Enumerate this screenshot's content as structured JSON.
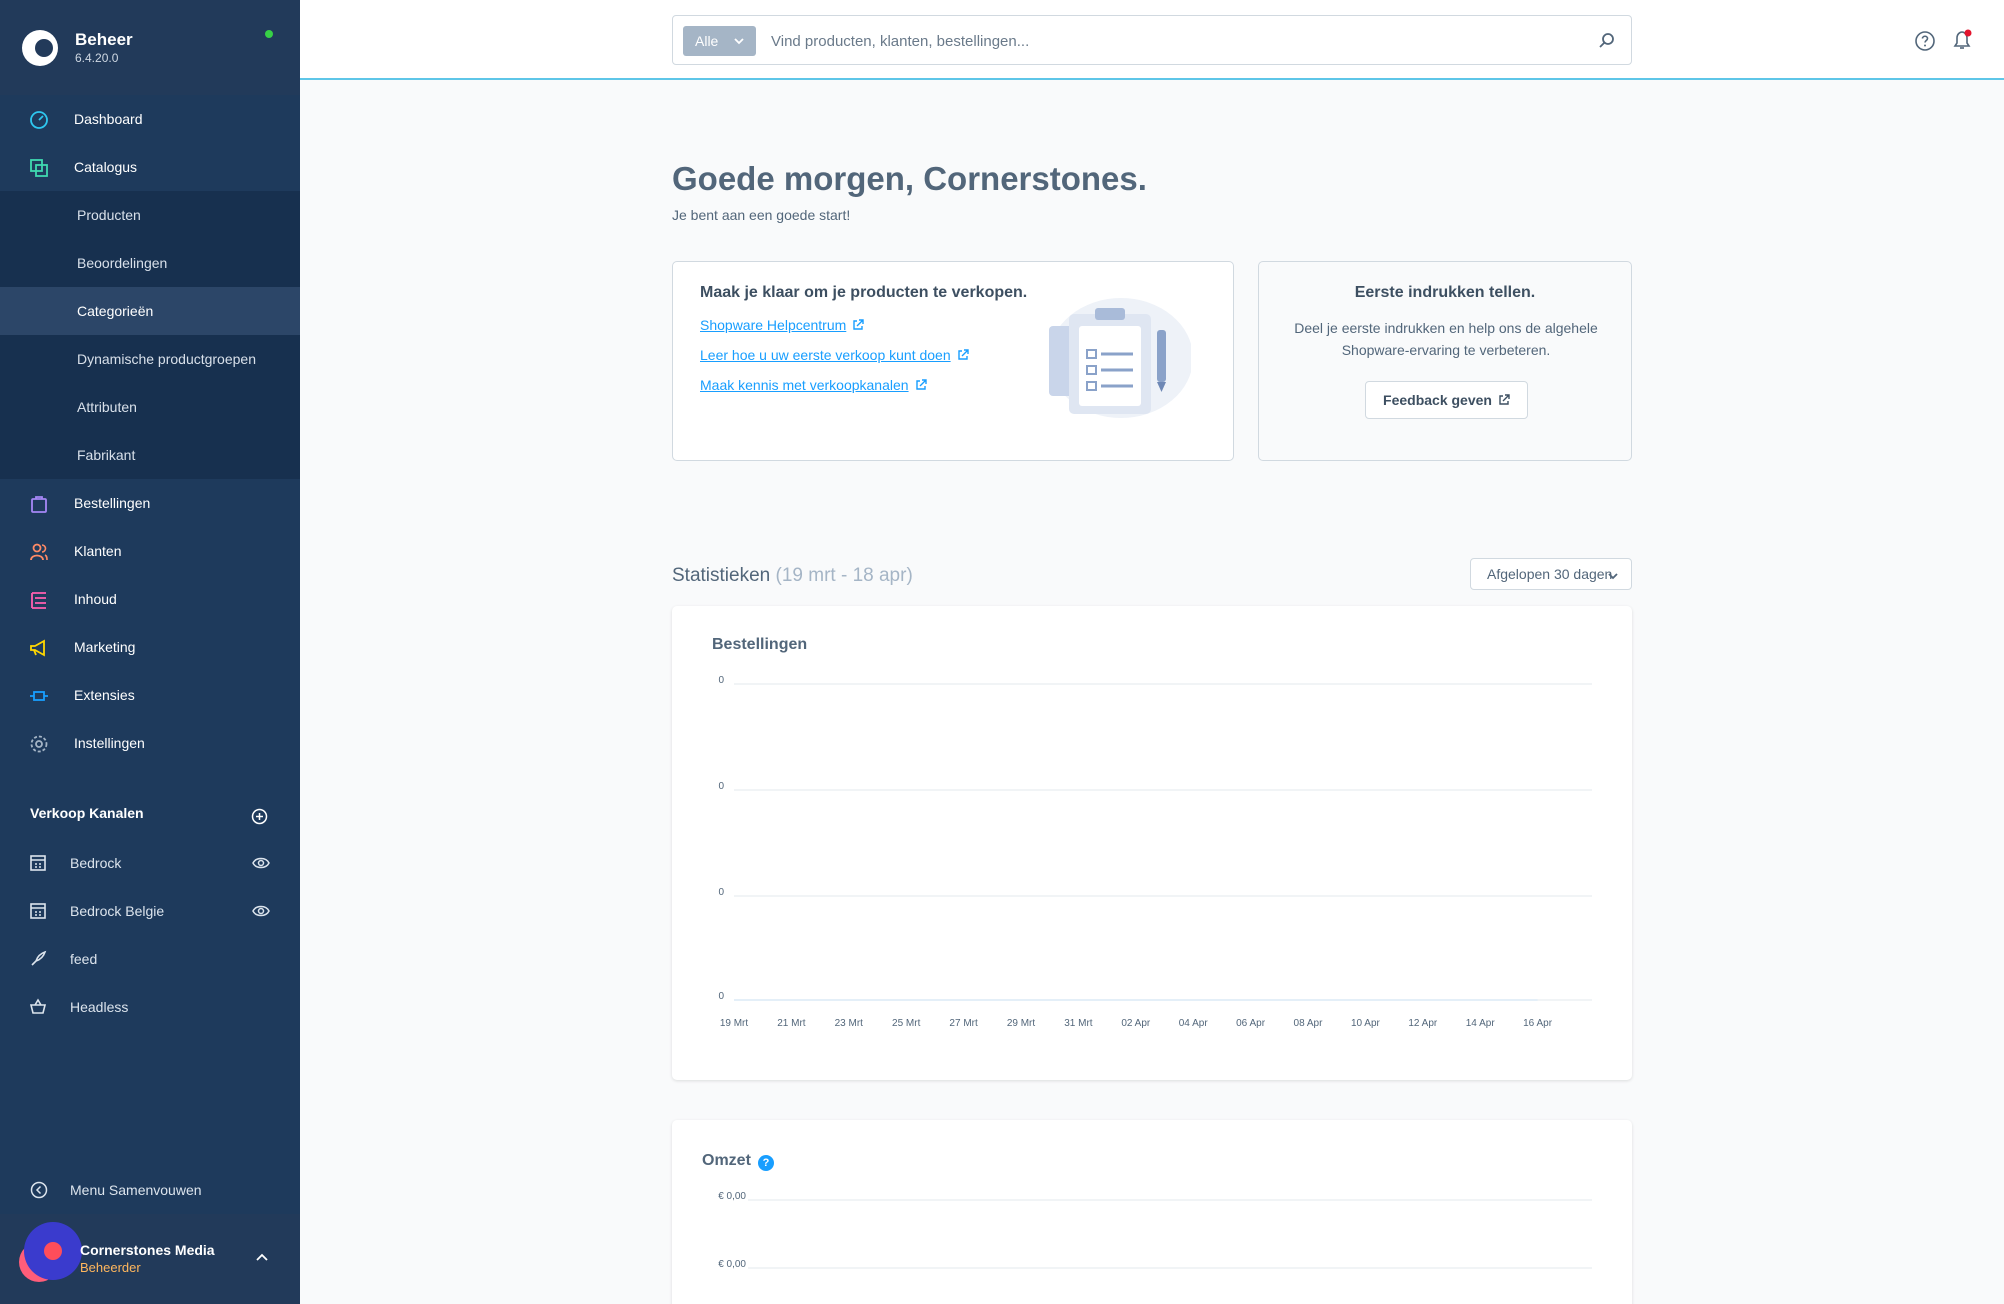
{
  "brand": {
    "name": "Beheer",
    "version": "6.4.20.0"
  },
  "nav": {
    "dashboard": "Dashboard",
    "catalogus": "Catalogus",
    "producten": "Producten",
    "beoordelingen": "Beoordelingen",
    "categorieen": "Categorieën",
    "dynamisch": "Dynamische productgroepen",
    "attributen": "Attributen",
    "fabrikant": "Fabrikant",
    "bestellingen": "Bestellingen",
    "klanten": "Klanten",
    "inhoud": "Inhoud",
    "marketing": "Marketing",
    "extensies": "Extensies",
    "instellingen": "Instellingen"
  },
  "sales_channels": {
    "heading": "Verkoop Kanalen",
    "items": [
      "Bedrock",
      "Bedrock Belgie",
      "feed",
      "Headless"
    ]
  },
  "collapse_label": "Menu Samenvouwen",
  "user": {
    "name": "Cornerstones Media",
    "role": "Beheerder"
  },
  "search": {
    "filter": "Alle",
    "placeholder": "Vind producten, klanten, bestellingen..."
  },
  "greeting": {
    "title": "Goede morgen, Cornerstones.",
    "subtitle": "Je bent aan een goede start!"
  },
  "ready_card": {
    "title": "Maak je klaar om je producten te verkopen.",
    "links": [
      "Shopware Helpcentrum",
      "Leer hoe u uw eerste verkoop kunt doen",
      "Maak kennis met verkoopkanalen"
    ]
  },
  "feedback_card": {
    "title": "Eerste indrukken tellen.",
    "text": "Deel je eerste indrukken en help ons de algehele Shopware-ervaring te verbeteren.",
    "button": "Feedback geven"
  },
  "stats": {
    "title": "Statistieken",
    "range": "(19 mrt - 18 apr)",
    "period": "Afgelopen 30 dagen"
  },
  "colors": {
    "sidebar": "#1e3a5c",
    "accent": "#189eff",
    "topbar_line": "#5ec6e8"
  },
  "chart_data": [
    {
      "type": "line",
      "title": "Bestellingen",
      "x": [
        "19 Mrt",
        "21 Mrt",
        "23 Mrt",
        "25 Mrt",
        "27 Mrt",
        "29 Mrt",
        "31 Mrt",
        "02 Apr",
        "04 Apr",
        "06 Apr",
        "08 Apr",
        "10 Apr",
        "12 Apr",
        "14 Apr",
        "16 Apr"
      ],
      "y_tick_labels": [
        "0",
        "0",
        "0",
        "0"
      ],
      "series": [
        {
          "values": [
            0,
            0,
            0,
            0,
            0,
            0,
            0,
            0,
            0,
            0,
            0,
            0,
            0,
            0,
            0
          ]
        }
      ],
      "grid": true
    },
    {
      "type": "line",
      "title": "Omzet",
      "y_tick_labels": [
        "€ 0,00",
        "€ 0,00"
      ],
      "grid": true
    }
  ]
}
